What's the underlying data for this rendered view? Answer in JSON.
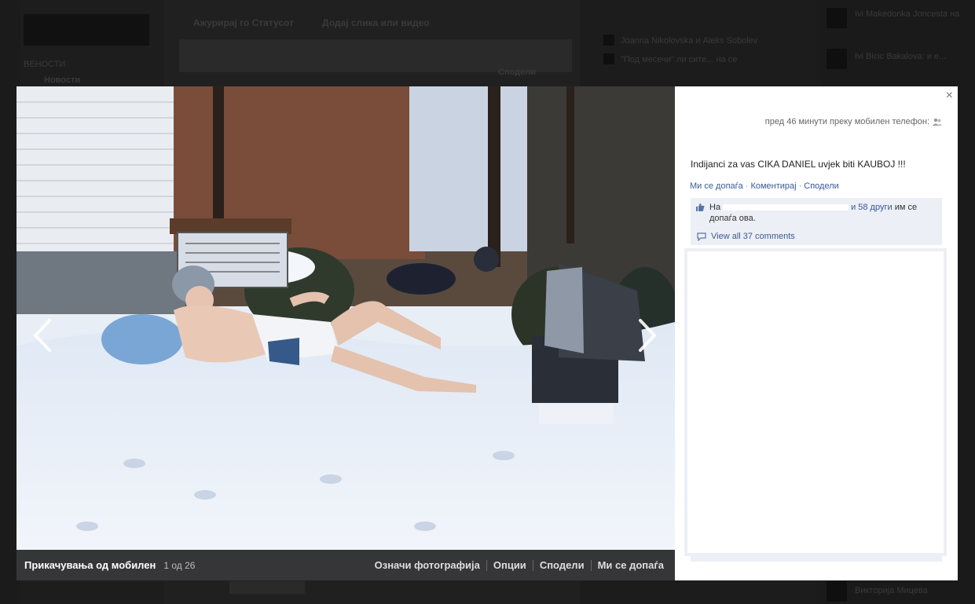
{
  "background": {
    "composer": "Ажурирај го Статусот",
    "composer_photo": "Додај слика или видео",
    "nav_item": "Новости",
    "sidebar_label": "ВЕНОСТИ",
    "share_button": "Сподели",
    "ticker": [
      "Ivi Makedonka Joncesta на",
      "Ivi Bicic Bakalova: и е...",
      "Викторија Мицева"
    ],
    "feed_snippets": [
      "Joanna Nikolovska и Aleks Sobolev",
      "\"Под месечи\" ли сите... на се"
    ]
  },
  "lightbox": {
    "album_title": "Прикачувања од мобилен",
    "photo_count": "1 од 26",
    "footer_actions": [
      "Означи фотографија",
      "Опции",
      "Сподели",
      "Ми се допаѓа"
    ],
    "close_label": "×",
    "meta": "пред 46 минути преку мобилен телефон:",
    "caption": "Indijanci za vas CIKA DANIEL uvjek biti KAUBOJ !!!",
    "actions": [
      "Ми се допаѓа",
      "Коментирај",
      "Сподели"
    ],
    "likes_prefix": "На",
    "likes_others": "и 58 други",
    "likes_suffix": "им се допаѓа ова.",
    "comments_link": "View all 37 comments"
  },
  "colors": {
    "link": "#3b5998",
    "panel_tint": "#eceff5",
    "overlay": "#141414"
  },
  "icons": {
    "prev": "chevron-left-icon",
    "next": "chevron-right-icon",
    "like": "thumbs-up-icon",
    "comment": "comment-bubble-icon",
    "privacy": "friends-icon",
    "close": "close-icon"
  }
}
